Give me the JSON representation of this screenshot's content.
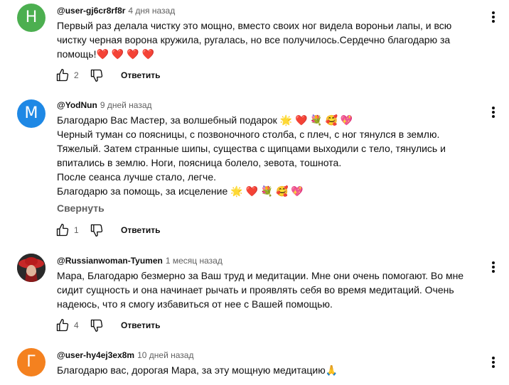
{
  "comments": [
    {
      "avatar_letter": "Н",
      "avatar_color": "#4caf50",
      "author": "@user-gj6cr8rf8r",
      "time": "4 дня назад",
      "lines": [
        "Первый раз делала чистку это мощно, вместо своих ног видела вороньи лапы, и всю",
        "чистку черная ворона кружила, ругалась, но все получилось.Сердечно благодарю за",
        "помощь!❤️ ❤️ ❤️ ❤️"
      ],
      "likes": "2",
      "reply_label": "Ответить"
    },
    {
      "avatar_letter": "M",
      "avatar_color": "#1e88e5",
      "author": "@YodNun",
      "time": "9 дней назад",
      "lines": [
        "Благодарю Вас Мастер, за волшебный подарок 🌟 ❤️ 💐 🥰 💖",
        "Черный туман со поясницы, с позвоночного столба, с плеч, с ног тянулся в землю.",
        "Тяжелый. Затем странные шипы, существа с щипцами выходили с тело, тянулись и",
        "впитались в землю. Ноги, поясница болело, зевота, тошнота.",
        "После сеанса лучше стало, легче.",
        "Благодарю за помощь, за исцеление 🌟 ❤️ 💐 🥰 💖"
      ],
      "collapse_label": "Свернуть",
      "likes": "1",
      "reply_label": "Ответить"
    },
    {
      "avatar_letter": "",
      "avatar_color": "#c62828",
      "author": "@Russianwoman-Tyumen",
      "time": "1 месяц назад",
      "lines": [
        "Мара, Благодарю безмерно за Ваш труд и медитации. Мне они очень помогают. Во мне",
        "сидит сущность и она начинает рычать и проявлять себя во время медитаций. Очень",
        "надеюсь, что я смогу избавиться от нее с Вашей помощью."
      ],
      "likes": "4",
      "reply_label": "Ответить"
    },
    {
      "avatar_letter": "Г",
      "avatar_color": "#f4811f",
      "author": "@user-hy4ej3ex8m",
      "time": "10 дней назад",
      "lines": [
        "Благодарю вас, дорогая Мара, за эту мощную медитацию🙏"
      ]
    }
  ]
}
